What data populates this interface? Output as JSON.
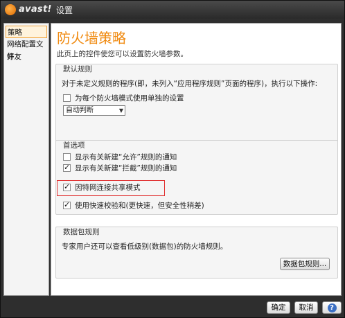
{
  "app": {
    "logo_text": "avast!",
    "title": "设置"
  },
  "sidebar": {
    "items": [
      {
        "label": "策略"
      },
      {
        "label": "网络配置文件"
      },
      {
        "label": "好友"
      }
    ]
  },
  "main": {
    "title": "防火墙策略",
    "description": "此页上的控件使您可以设置防火墙参数。",
    "default_rules": {
      "title": "默认规则",
      "description": "对于未定义规则的程序(即，未列入“应用程序规则”页面的程序)，执行以下操作:",
      "checkbox_label": "为每个防火墙模式使用单独的设置",
      "select_value": "自动判断"
    },
    "preferences": {
      "title": "首选项",
      "items": [
        {
          "label": "显示有关新建“允许”规则的通知",
          "checked": false
        },
        {
          "label": "显示有关新建“拦截”规则的通知",
          "checked": true
        },
        {
          "label": "因特网连接共享模式",
          "checked": true
        },
        {
          "label": "使用快速校验和(更快速，但安全性稍差)",
          "checked": true
        }
      ]
    },
    "packet_rules": {
      "title": "数据包规则",
      "description": "专家用户还可以查看低级别(数据包)的防火墙规则。",
      "button_label": "数据包规则..."
    }
  },
  "footer": {
    "ok_label": "确定",
    "cancel_label": "取消",
    "help_icon_glyph": "?"
  },
  "colors": {
    "accent": "#f08a10",
    "highlight_border": "#e03030"
  }
}
